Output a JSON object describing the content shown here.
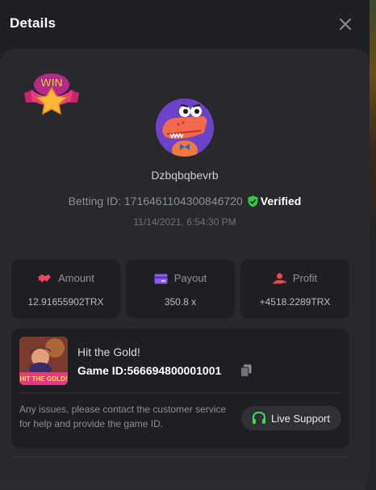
{
  "modal": {
    "title": "Details",
    "close_icon": "close-icon"
  },
  "player": {
    "badge_text": "WIN",
    "username": "Dzbqbqbevrb",
    "betting_id_label": "Betting ID:",
    "betting_id": "1716461104300846720",
    "verified_label": "Verified",
    "datetime": "11/14/2021, 6:54:30 PM"
  },
  "stats": [
    {
      "icon": "handshake-icon",
      "label": "Amount",
      "value": "12.91655902TRX"
    },
    {
      "icon": "card-icon",
      "label": "Payout",
      "value": "350.8 x"
    },
    {
      "icon": "profit-icon",
      "label": "Profit",
      "value": "+4518.2289TRX"
    }
  ],
  "game": {
    "thumbnail_text": "HIT THE GOLD!",
    "name": "Hit the Gold!",
    "id_label": "Game ID:",
    "id": "566694800001001",
    "notice": "Any issues, please contact the customer service for help and provide the game ID.",
    "support_label": "Live Support"
  },
  "colors": {
    "verified": "#2ecc40",
    "amount_icon": "#e8475f",
    "payout_icon": "#8a5cf6",
    "profit_icon": "#e84a4a",
    "support_icon": "#3ddc56"
  }
}
